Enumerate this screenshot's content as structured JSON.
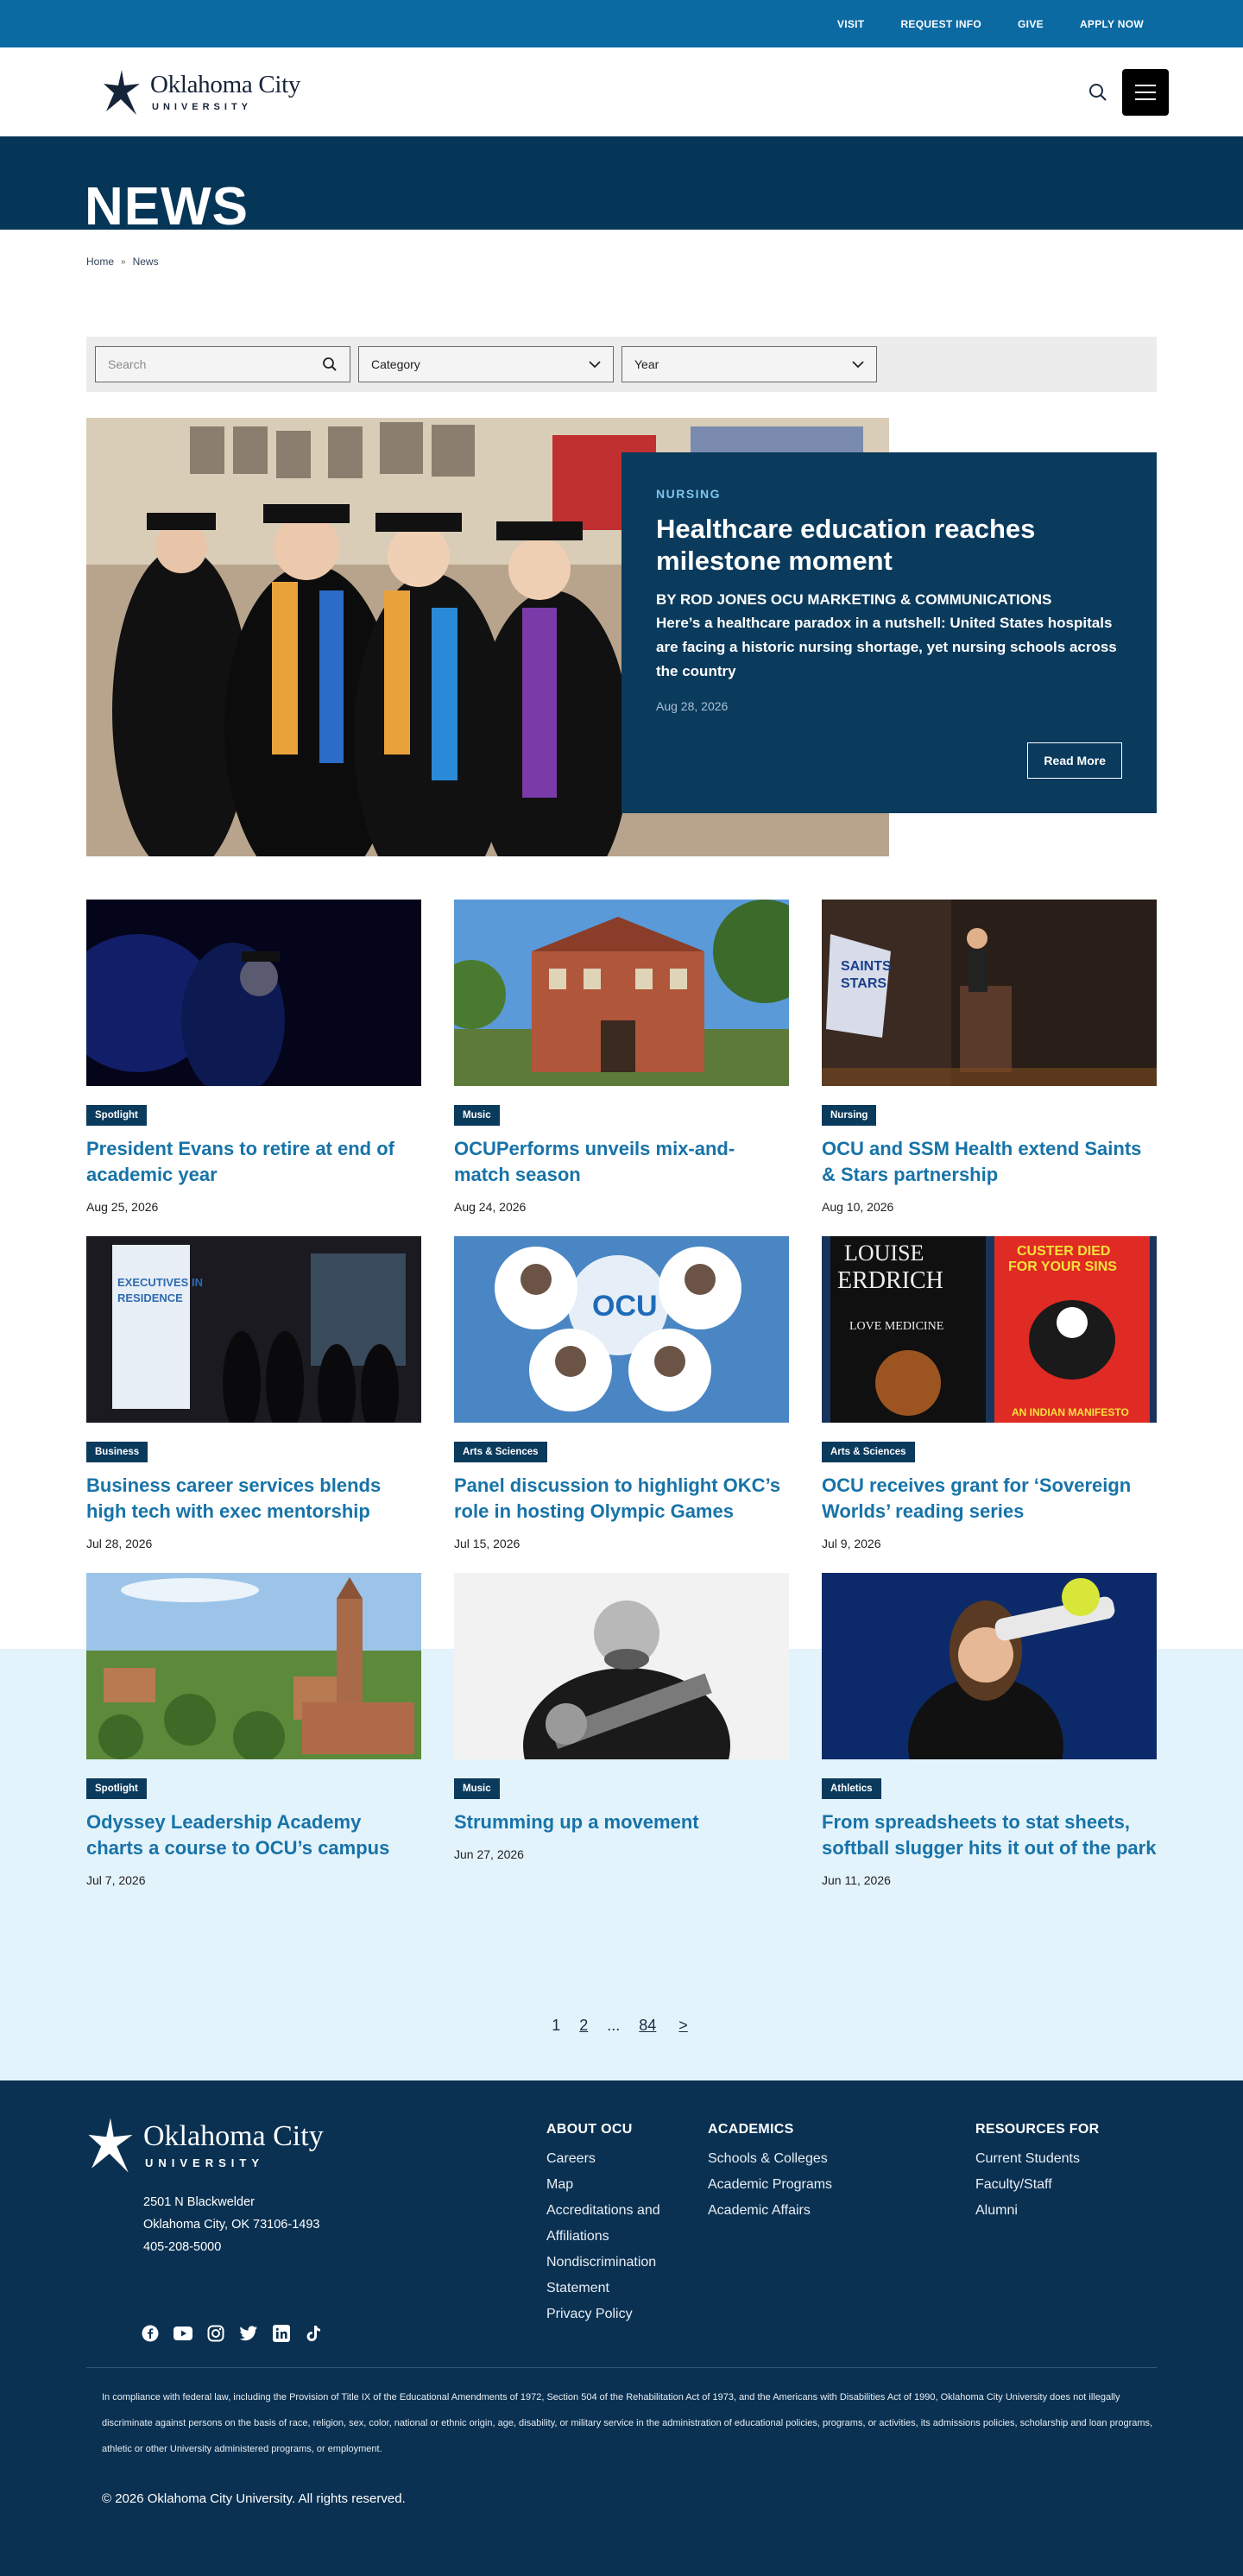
{
  "utility_nav": [
    "VISIT",
    "REQUEST INFO",
    "GIVE",
    "APPLY NOW"
  ],
  "logo": {
    "name": "Oklahoma City",
    "sub": "UNIVERSITY"
  },
  "page_title": "NEWS",
  "breadcrumb": {
    "home": "Home",
    "current": "News"
  },
  "filters": {
    "search_placeholder": "Search",
    "category": "Category",
    "year": "Year"
  },
  "featured": {
    "category": "NURSING",
    "title": "Healthcare education reaches milestone moment",
    "byline": "BY ROD JONES OCU MARKETING & COMMUNICATIONS",
    "excerpt": "Here’s a healthcare paradox in a nutshell: United States hospitals are facing a historic nursing shortage, yet nursing schools across the country",
    "date": "Aug 28, 2026",
    "button": "Read More"
  },
  "articles": [
    {
      "tag": "Spotlight",
      "title": "President Evans to retire at end of academic year",
      "date": "Aug 25, 2026"
    },
    {
      "tag": "Music",
      "title": "OCUPerforms unveils mix-and-match season",
      "date": "Aug 24, 2026"
    },
    {
      "tag": "Nursing",
      "title": "OCU and SSM Health extend Saints & Stars partnership",
      "date": "Aug 10, 2026"
    },
    {
      "tag": "Business",
      "title": "Business career services blends high tech with exec mentorship",
      "date": "Jul 28, 2026"
    },
    {
      "tag": "Arts & Sciences",
      "title": "Panel discussion to highlight OKC’s role in hosting Olympic Games",
      "date": "Jul 15, 2026"
    },
    {
      "tag": "Arts & Sciences",
      "title": "OCU receives grant for ‘Sovereign Worlds’ reading series",
      "date": "Jul 9, 2026"
    },
    {
      "tag": "Spotlight",
      "title": "Odyssey Leadership Academy charts a course to OCU’s campus",
      "date": "Jul 7, 2026"
    },
    {
      "tag": "Music",
      "title": "Strumming up a movement",
      "date": "Jun 27, 2026"
    },
    {
      "tag": "Athletics",
      "title": "From spreadsheets to stat sheets, softball slugger hits it out of the park",
      "date": "Jun 11, 2026"
    }
  ],
  "image_text": {
    "saints": "SAINTS",
    "stars": "STARS",
    "executives": "EXECUTIVES IN",
    "residence": "RESIDENCE",
    "ocu": "OCU",
    "louise": "LOUISE",
    "erdrich": "ERDRICH",
    "love_medicine": "LOVE MEDICINE",
    "custer1": "CUSTER DIED",
    "custer2": "FOR YOUR SINS",
    "manifesto": "AN INDIAN MANIFESTO"
  },
  "pagination": [
    "1",
    "2",
    "...",
    "84",
    ">"
  ],
  "footer": {
    "address": [
      "2501 N Blackwelder",
      "Oklahoma City, OK 73106-1493",
      "405-208-5000"
    ],
    "about": {
      "heading": "ABOUT OCU",
      "links": [
        "Careers",
        "Map",
        "Accreditations and",
        "Affiliations",
        "Nondiscrimination",
        "Statement",
        "Privacy Policy"
      ]
    },
    "academics": {
      "heading": "ACADEMICS",
      "links": [
        "Schools & Colleges",
        "Academic Programs",
        "Academic Affairs"
      ]
    },
    "resources": {
      "heading": "RESOURCES FOR",
      "links": [
        "Current Students",
        "Faculty/Staff",
        "Alumni"
      ]
    },
    "legal": "In compliance with federal law, including the Provision of Title IX of the Educational Amendments of 1972, Section 504 of the Rehabilitation Act of 1973, and the Americans with Disabilities Act of 1990, Oklahoma City University does not illegally discriminate against persons on the basis of race, religion, sex, color, national or ethnic origin, age, disability, or military service in the administration of educational policies, programs, or activities, its admissions policies, scholarship and loan programs, athletic or other University administered programs, or employment.",
    "copyright": "© 2026 Oklahoma City University. All rights reserved."
  },
  "colors": {
    "brand_navy": "#0a3a5c",
    "utility_blue": "#0b6aa2",
    "link_blue": "#1773a8",
    "light_band": "#e3f3fb"
  }
}
